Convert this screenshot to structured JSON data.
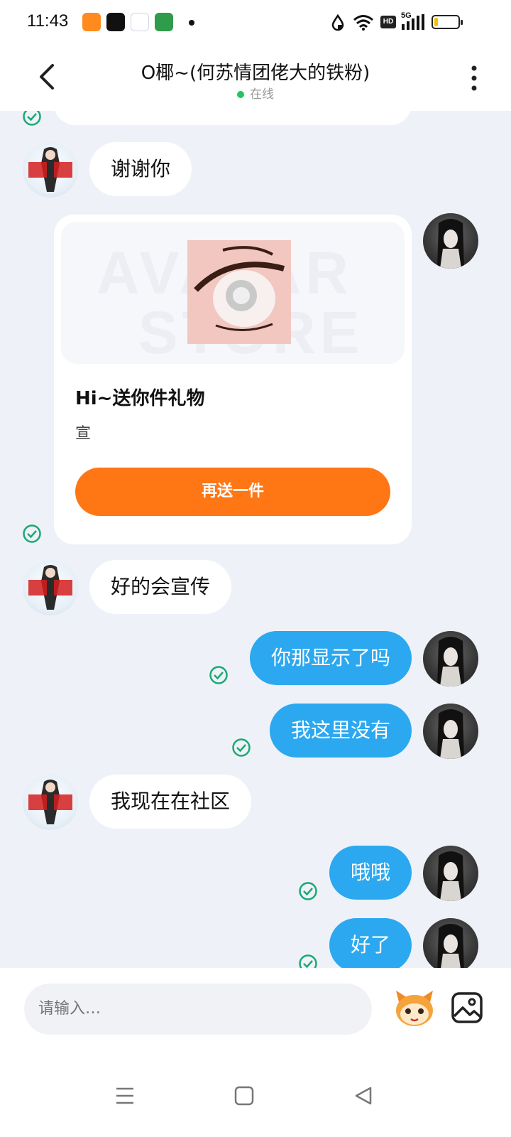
{
  "status_bar": {
    "time": "11:43",
    "hd_label": "HD",
    "network": "5G"
  },
  "header": {
    "title": "O椰~(何苏情团佬大的铁粉)",
    "status": "在线"
  },
  "colors": {
    "outgoing_bubble": "#2ba8f0",
    "incoming_bubble": "#ffffff",
    "accent_button": "#ff7614",
    "online_dot": "#22c55e",
    "sent_check": "#1aa971"
  },
  "messages": {
    "m1": {
      "text": "谢谢你",
      "sender": "peer"
    },
    "gift": {
      "title": "Hi~送你件礼物",
      "subtitle": "宣",
      "button": "再送一件"
    },
    "m2": {
      "text": "好的会宣传",
      "sender": "peer"
    },
    "m3": {
      "text": "你那显示了吗",
      "sender": "me"
    },
    "m4": {
      "text": "我这里没有",
      "sender": "me"
    },
    "m5": {
      "text": "我现在在社区",
      "sender": "peer"
    },
    "m6": {
      "text": "哦哦",
      "sender": "me"
    },
    "m7": {
      "text": "好了",
      "sender": "me"
    }
  },
  "input": {
    "placeholder": "请输入…"
  },
  "icons": {
    "back": "chevron-left-icon",
    "more": "more-vertical-icon",
    "sent": "check-circle-icon",
    "mascot": "mascot-icon",
    "image": "image-icon",
    "nav_menu": "menu-icon",
    "nav_home": "home-square-icon",
    "nav_back": "triangle-back-icon"
  }
}
